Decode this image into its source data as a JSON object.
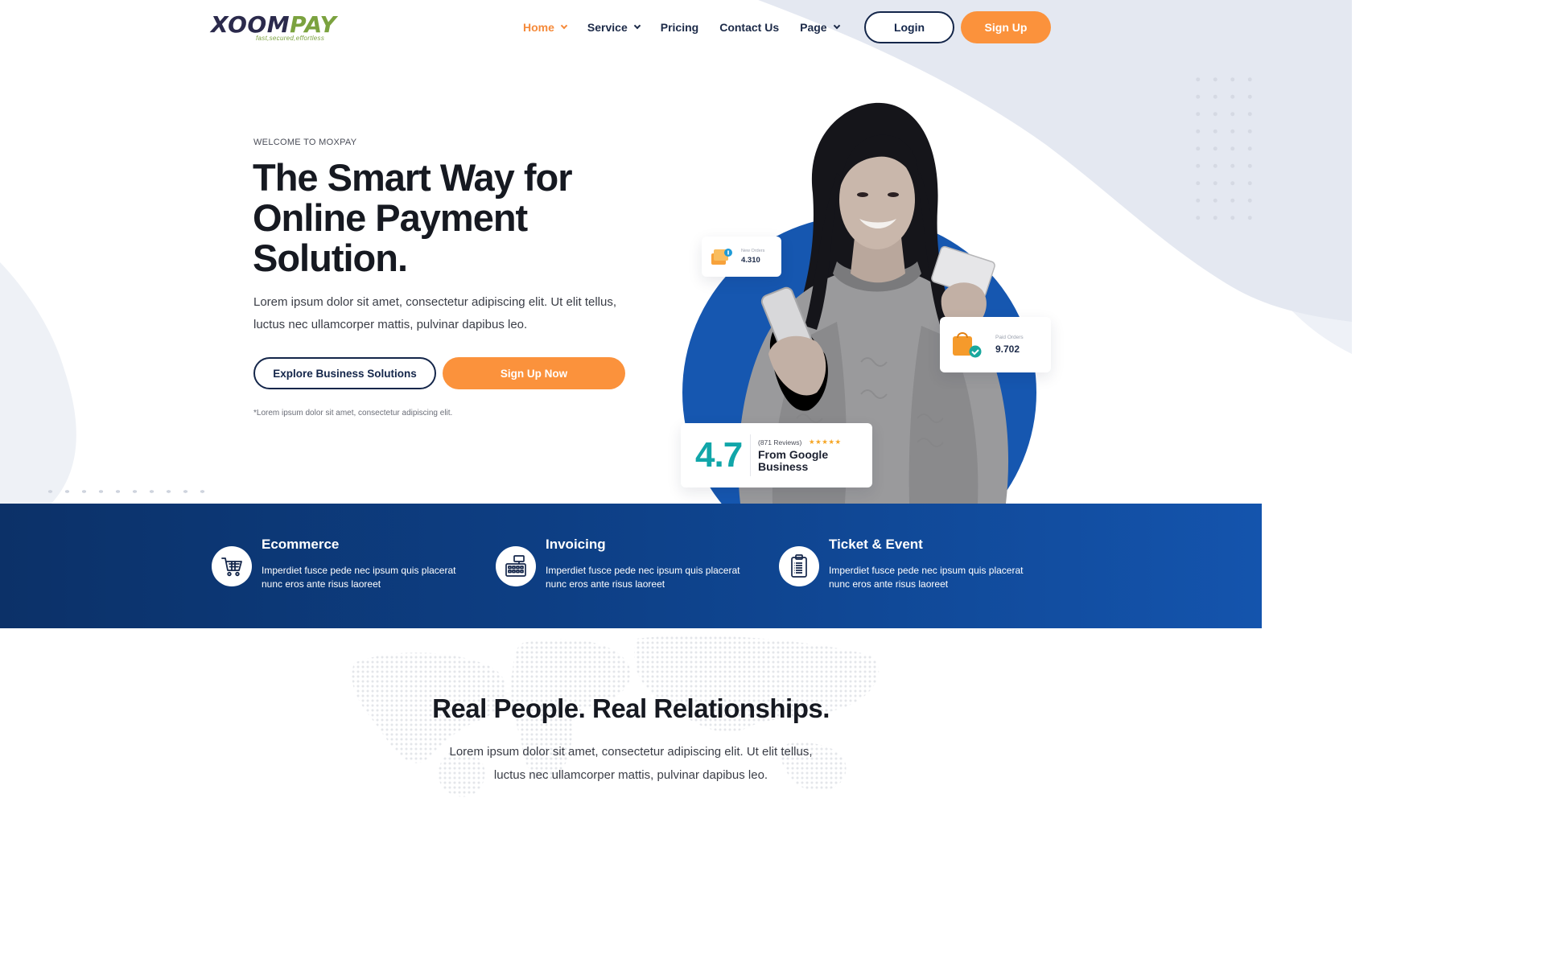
{
  "brand": {
    "logo_main_a": "XOOM",
    "logo_main_b": "PAY",
    "logo_tagline": "fast,secured,effortless",
    "primary_color": "#14264a",
    "accent_color": "#fb923c",
    "band_color": "#0d3f85"
  },
  "nav": {
    "items": [
      {
        "label": "Home",
        "active": true,
        "dropdown": true
      },
      {
        "label": "Service",
        "active": false,
        "dropdown": true
      },
      {
        "label": "Pricing",
        "active": false,
        "dropdown": false
      },
      {
        "label": "Contact Us",
        "active": false,
        "dropdown": false
      },
      {
        "label": "Page",
        "active": false,
        "dropdown": true
      }
    ],
    "login_label": "Login",
    "signup_label": "Sign Up"
  },
  "hero": {
    "eyebrow": "WELCOME TO MOXPAY",
    "title": "The Smart Way for Online Payment Solution.",
    "description": "Lorem ipsum dolor sit amet, consectetur adipiscing elit. Ut elit tellus, luctus nec ullamcorper mattis, pulvinar dapibus leo.",
    "explore_label": "Explore Business Solutions",
    "signup_now_label": "Sign Up Now",
    "note": "*Lorem ipsum dolor sit amet, consectetur adipiscing elit."
  },
  "stats": {
    "new_orders_label": "New Orders",
    "new_orders_value": "4.310",
    "paid_orders_label": "Paid Orders",
    "paid_orders_value": "9.702"
  },
  "review": {
    "rating": "4.7",
    "count": "(871 Reviews)",
    "stars": "★★★★★",
    "source": "From Google Business"
  },
  "features": [
    {
      "icon": "cart-icon",
      "title": "Ecommerce",
      "description": "Imperdiet fusce pede nec ipsum quis placerat nunc eros ante risus laoreet"
    },
    {
      "icon": "cash-register-icon",
      "title": "Invoicing",
      "description": "Imperdiet fusce pede nec ipsum quis placerat nunc eros ante risus laoreet"
    },
    {
      "icon": "ticket-clipboard-icon",
      "title": "Ticket & Event",
      "description": "Imperdiet fusce pede nec ipsum quis placerat nunc eros ante risus laoreet"
    }
  ],
  "relationships": {
    "title": "Real People. Real Relationships.",
    "description": "Lorem ipsum dolor sit amet, consectetur adipiscing elit. Ut elit tellus, luctus nec ullamcorper mattis, pulvinar dapibus leo."
  }
}
